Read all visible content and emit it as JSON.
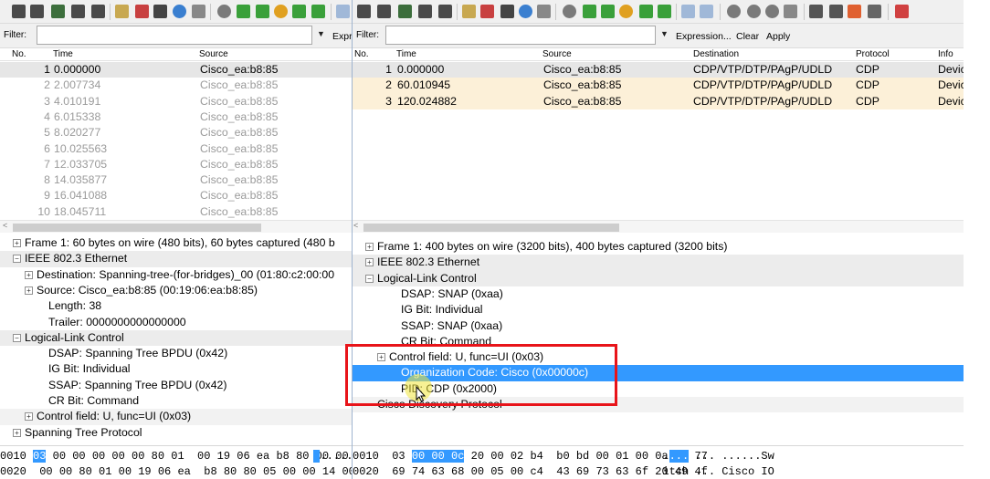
{
  "colors": {
    "selected_row": "#3399ff",
    "cdp_row": "#fcf0d8",
    "highlight_box": "#e8141a"
  },
  "left": {
    "filter": {
      "label": "Filter:",
      "value": "",
      "expression_label": "Expr"
    },
    "columns": [
      "No.",
      "Time",
      "Source"
    ],
    "packets": [
      {
        "no": "1",
        "time": "0.000000",
        "source": "Cisco_ea:b8:85"
      },
      {
        "no": "2",
        "time": "2.007734",
        "source": "Cisco_ea:b8:85"
      },
      {
        "no": "3",
        "time": "4.010191",
        "source": "Cisco_ea:b8:85"
      },
      {
        "no": "4",
        "time": "6.015338",
        "source": "Cisco_ea:b8:85"
      },
      {
        "no": "5",
        "time": "8.020277",
        "source": "Cisco_ea:b8:85"
      },
      {
        "no": "6",
        "time": "10.025563",
        "source": "Cisco_ea:b8:85"
      },
      {
        "no": "7",
        "time": "12.033705",
        "source": "Cisco_ea:b8:85"
      },
      {
        "no": "8",
        "time": "14.035877",
        "source": "Cisco_ea:b8:85"
      },
      {
        "no": "9",
        "time": "16.041088",
        "source": "Cisco_ea:b8:85"
      },
      {
        "no": "10",
        "time": "18.045711",
        "source": "Cisco_ea:b8:85"
      }
    ],
    "tree": [
      {
        "text": "Frame 1: 60 bytes on wire (480 bits), 60 bytes captured (480 b",
        "indent": 0,
        "expander": "+",
        "style": ""
      },
      {
        "text": "IEEE 802.3 Ethernet",
        "indent": 0,
        "expander": "−",
        "style": "hdr"
      },
      {
        "text": "Destination: Spanning-tree-(for-bridges)_00 (01:80:c2:00:00",
        "indent": 1,
        "expander": "+",
        "style": ""
      },
      {
        "text": "Source: Cisco_ea:b8:85 (00:19:06:ea:b8:85)",
        "indent": 1,
        "expander": "+",
        "style": ""
      },
      {
        "text": "Length: 38",
        "indent": 2,
        "expander": "",
        "style": ""
      },
      {
        "text": "Trailer: 0000000000000000",
        "indent": 2,
        "expander": "",
        "style": ""
      },
      {
        "text": "Logical-Link Control",
        "indent": 0,
        "expander": "−",
        "style": "hdr"
      },
      {
        "text": "DSAP: Spanning Tree BPDU (0x42)",
        "indent": 2,
        "expander": "",
        "style": ""
      },
      {
        "text": "IG Bit: Individual",
        "indent": 2,
        "expander": "",
        "style": ""
      },
      {
        "text": "SSAP: Spanning Tree BPDU (0x42)",
        "indent": 2,
        "expander": "",
        "style": ""
      },
      {
        "text": "CR Bit: Command",
        "indent": 2,
        "expander": "",
        "style": ""
      },
      {
        "text": "Control field: U, func=UI (0x03)",
        "indent": 1,
        "expander": "+",
        "style": "mid"
      },
      {
        "text": "Spanning Tree Protocol",
        "indent": 0,
        "expander": "+",
        "style": ""
      }
    ],
    "hex": [
      {
        "offset": "0010",
        "pre": " ",
        "hl": "03",
        "post": " 00 00 00 00 00 80 01  00 19 06 ea b8 80 00 00",
        "ascii_pre": " ",
        "ascii_hl": " ",
        "ascii_post": "......."
      },
      {
        "offset": "0020",
        "pre": "  00 00 80 01 00 19 06 ea  b8 80 80 05 00 00 14 00",
        "hl": "",
        "post": "",
        "ascii_pre": "",
        "ascii_hl": "",
        "ascii_post": ""
      }
    ]
  },
  "right": {
    "filter": {
      "label": "Filter:",
      "value": "",
      "expression_label": "Expression...",
      "clear_label": "Clear",
      "apply_label": "Apply"
    },
    "columns": [
      "No.",
      "Time",
      "Source",
      "Destination",
      "Protocol",
      "Info"
    ],
    "packets": [
      {
        "no": "1",
        "time": "0.000000",
        "source": "Cisco_ea:b8:85",
        "destination": "CDP/VTP/DTP/PAgP/UDLD",
        "protocol": "CDP",
        "info": "Devic"
      },
      {
        "no": "2",
        "time": "60.010945",
        "source": "Cisco_ea:b8:85",
        "destination": "CDP/VTP/DTP/PAgP/UDLD",
        "protocol": "CDP",
        "info": "Devic"
      },
      {
        "no": "3",
        "time": "120.024882",
        "source": "Cisco_ea:b8:85",
        "destination": "CDP/VTP/DTP/PAgP/UDLD",
        "protocol": "CDP",
        "info": "Devic"
      }
    ],
    "tree": [
      {
        "text": "Frame 1: 400 bytes on wire (3200 bits), 400 bytes captured (3200 bits)",
        "indent": 0,
        "expander": "+",
        "style": ""
      },
      {
        "text": "IEEE 802.3 Ethernet",
        "indent": 0,
        "expander": "+",
        "style": "hdr"
      },
      {
        "text": "Logical-Link Control",
        "indent": 0,
        "expander": "−",
        "style": "hdr"
      },
      {
        "text": "DSAP: SNAP (0xaa)",
        "indent": 2,
        "expander": "",
        "style": ""
      },
      {
        "text": "IG Bit: Individual",
        "indent": 2,
        "expander": "",
        "style": ""
      },
      {
        "text": "SSAP: SNAP (0xaa)",
        "indent": 2,
        "expander": "",
        "style": ""
      },
      {
        "text": "CR Bit: Command",
        "indent": 2,
        "expander": "",
        "style": ""
      },
      {
        "text": "Control field: U, func=UI (0x03)",
        "indent": 1,
        "expander": "+",
        "style": ""
      },
      {
        "text": "Organization Code: Cisco (0x00000c)",
        "indent": 2,
        "expander": "",
        "style": "sel"
      },
      {
        "text": "PID: CDP (0x2000)",
        "indent": 2,
        "expander": "",
        "style": ""
      },
      {
        "text": "Cisco Discovery Protocol",
        "indent": 0,
        "expander": "",
        "style": "mid"
      }
    ],
    "hex": [
      {
        "offset": "0010",
        "pre": "  03 ",
        "hl": "00 00 0c",
        "post": " 20 00 02 b4  b0 bd 00 01 00 0a 53 77",
        "ascii_pre": "  .",
        "ascii_hl": "...",
        "ascii_post": " ... ......Sw"
      },
      {
        "offset": "0020",
        "pre": "  69 74 63 68 00 05 00 c4  43 69 73 63 6f 20 49 4f",
        "hl": "",
        "post": "",
        "ascii_pre": "  itch",
        "ascii_hl": "",
        "ascii_post": " ... Cisco IO"
      }
    ]
  }
}
